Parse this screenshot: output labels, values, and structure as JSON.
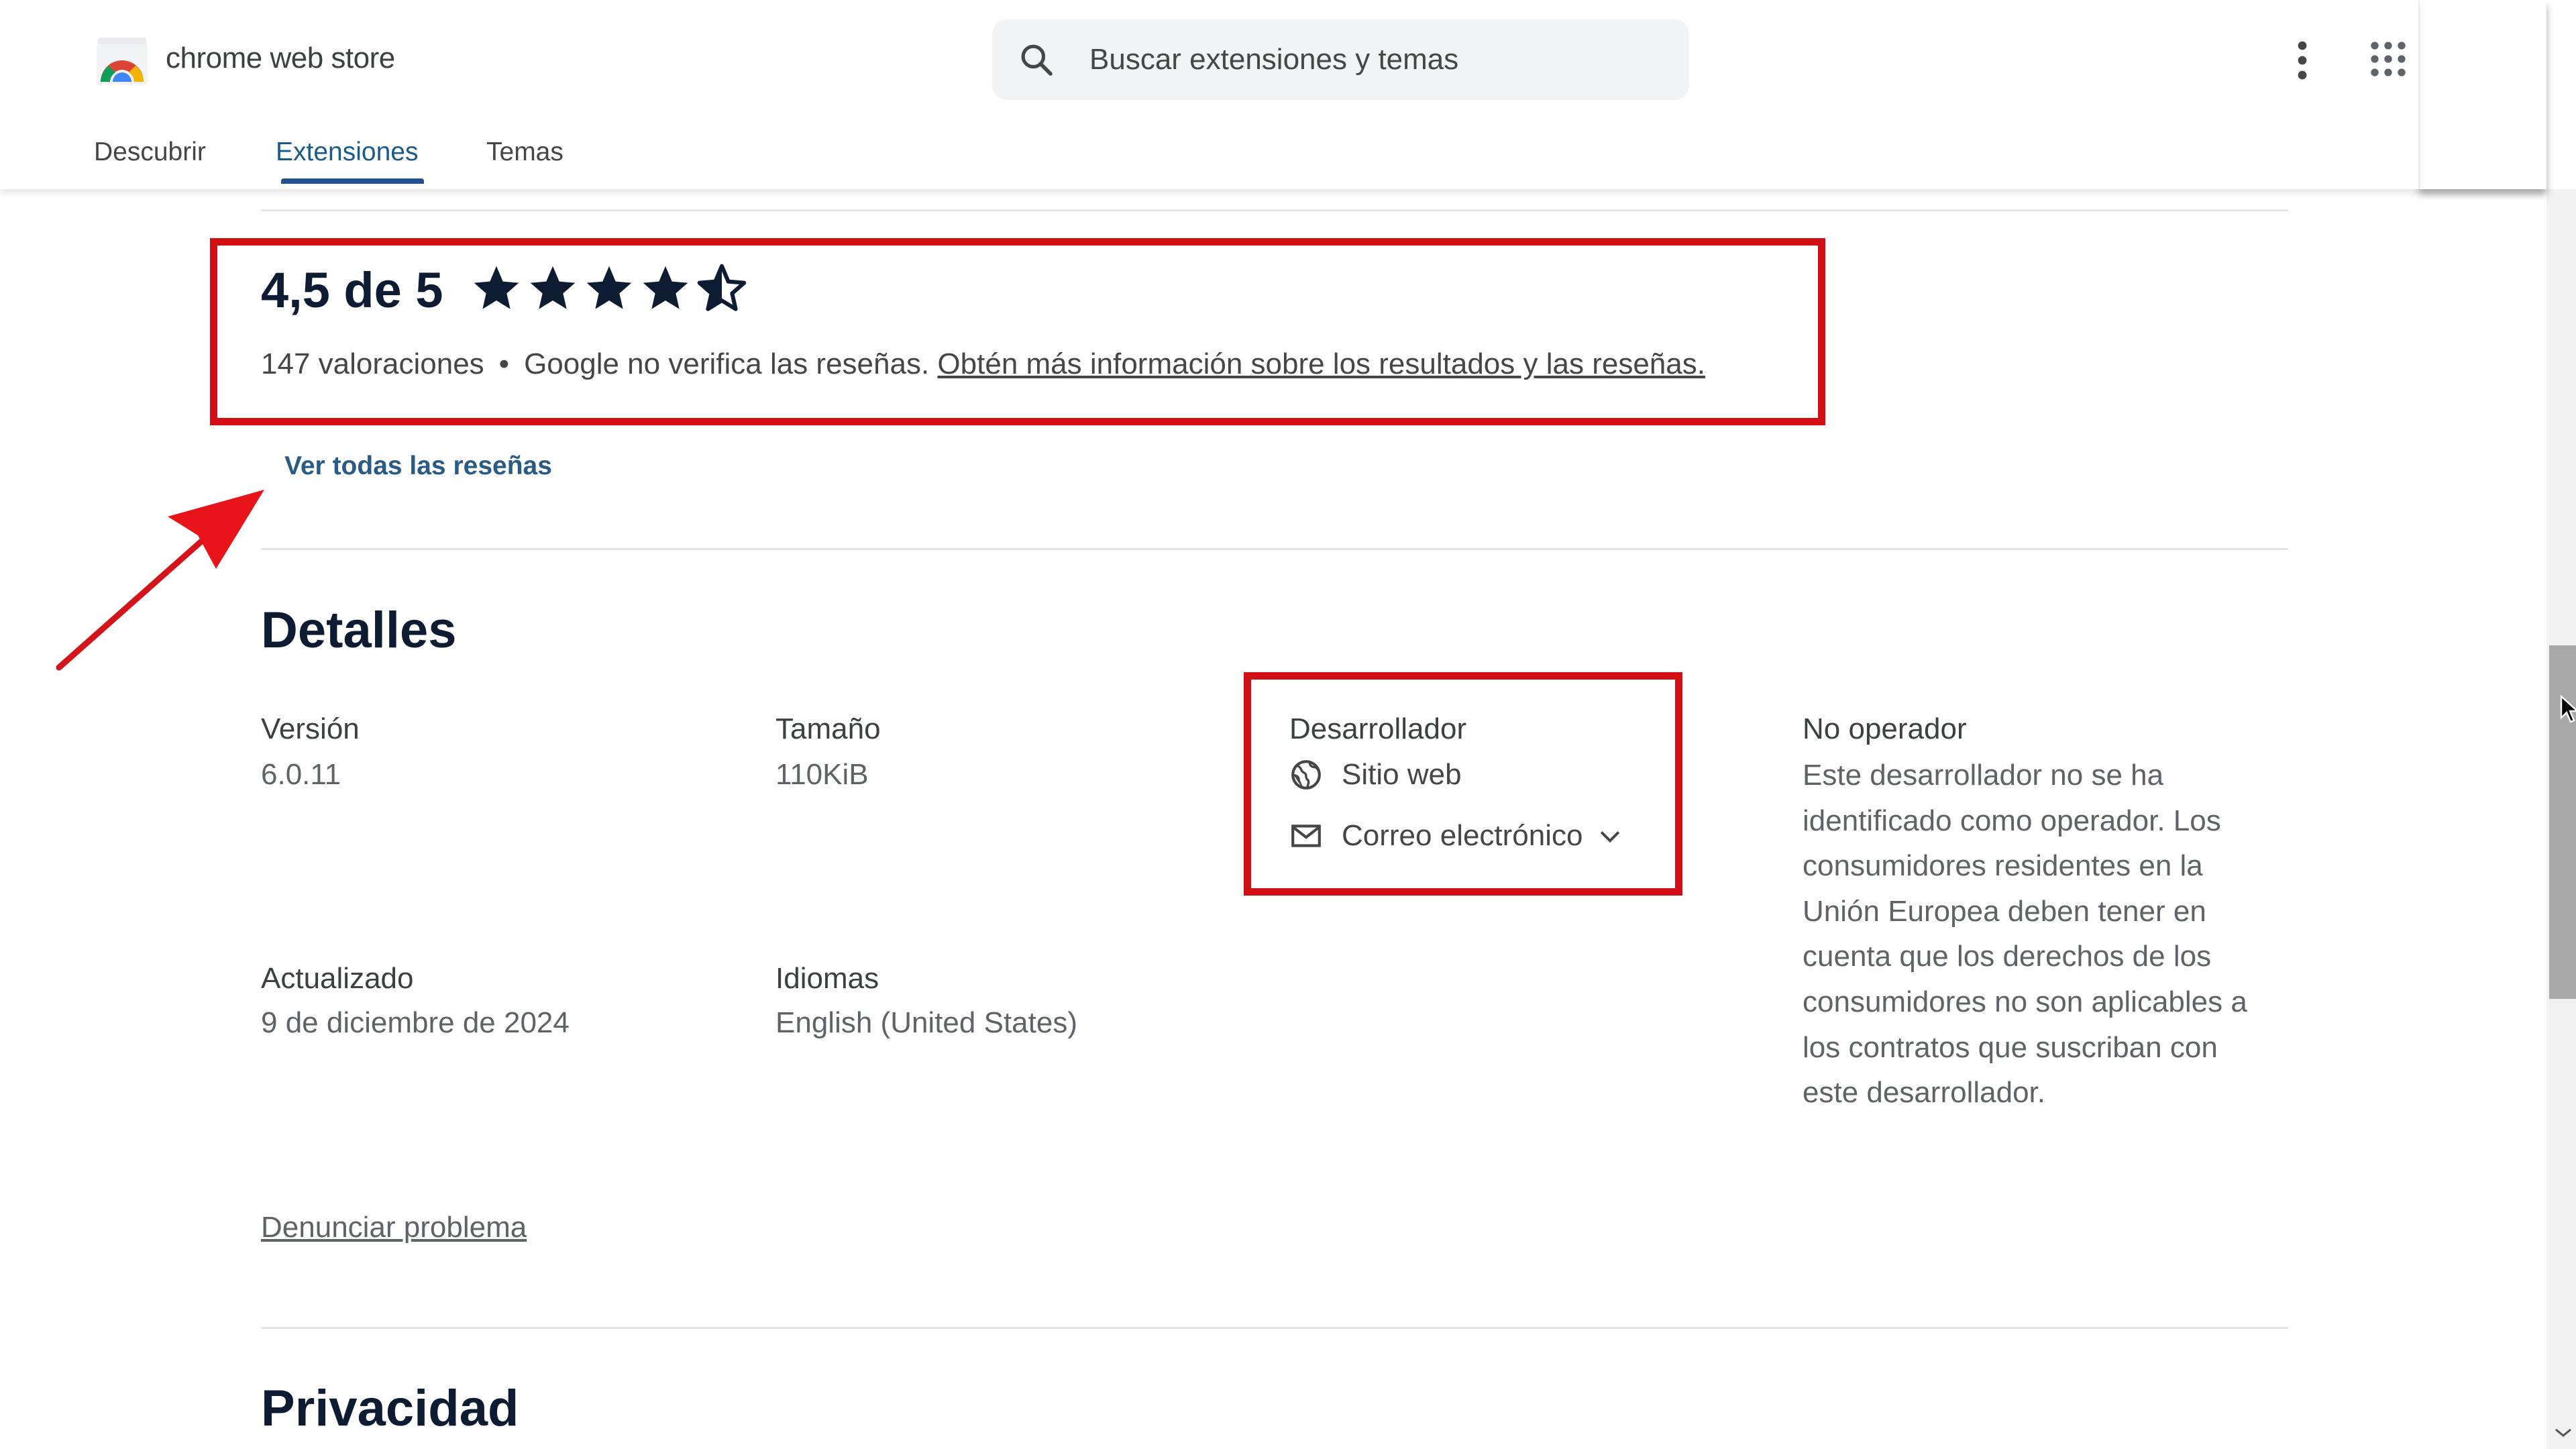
{
  "header": {
    "brand": "chrome web store",
    "search_placeholder": "Buscar extensiones y temas",
    "tabs": [
      {
        "label": "Descubrir",
        "active": false
      },
      {
        "label": "Extensiones",
        "active": true
      },
      {
        "label": "Temas",
        "active": false
      }
    ],
    "icons": [
      "chrome-web-store-logo",
      "search-icon",
      "more-vert-icon",
      "apps-grid-icon"
    ]
  },
  "rating": {
    "value": 4.5,
    "max": 5,
    "title": "4,5 de 5",
    "count_text": "147 valoraciones",
    "separator": "•",
    "disclaimer": "Google no verifica las reseñas.",
    "learn_more": "Obtén más información sobre los resultados y las reseñas.",
    "see_all": "Ver todas las reseñas"
  },
  "details": {
    "title": "Detalles",
    "version_label": "Versión",
    "version": "6.0.11",
    "size_label": "Tamaño",
    "size": "110KiB",
    "developer_label": "Desarrollador",
    "website": "Sitio web",
    "email": "Correo electrónico",
    "trader_label": "No operador",
    "trader_text": "Este desarrollador no se ha identificado como operador. Los consumidores residentes en la Unión Europea deben tener en cuenta que los derechos de los consumidores no son aplicables a los contratos que suscriban con este desarrollador.",
    "updated_label": "Actualizado",
    "updated": "9 de diciembre de 2024",
    "languages_label": "Idiomas",
    "languages": "English (United States)",
    "report": "Denunciar problema"
  },
  "privacy": {
    "title": "Privacidad"
  },
  "colors": {
    "annotation_red": "#d20f14",
    "heading_navy": "#0d1b33",
    "link_blue": "#2a5b84",
    "tab_active_underline": "#23508e"
  },
  "scrollbar": {
    "position_fraction": 0.36
  }
}
